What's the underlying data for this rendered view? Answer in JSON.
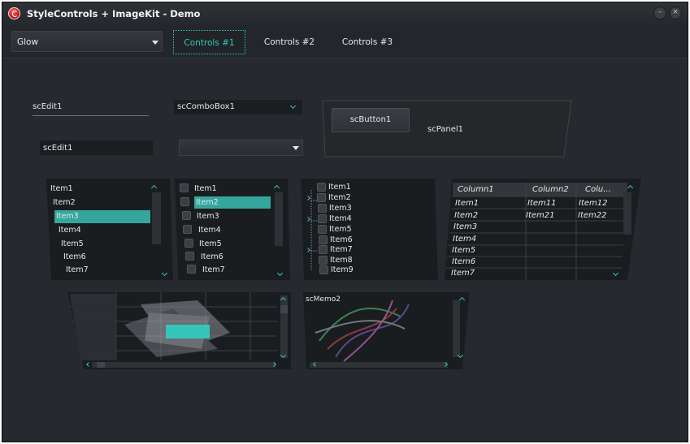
{
  "window": {
    "title": "StyleControls + ImageKit  - Demo",
    "minimize_glyph": "–",
    "close_glyph": "×"
  },
  "style_combo": {
    "value": "Glow"
  },
  "tabs": [
    {
      "label": "Controls #1",
      "active": true
    },
    {
      "label": "Controls #2",
      "active": false
    },
    {
      "label": "Controls #3",
      "active": false
    }
  ],
  "edits": {
    "edit1": "scEdit1",
    "edit2": "scEdit1"
  },
  "combos": {
    "combo1": "scComboBox1",
    "combo2": ""
  },
  "panel": {
    "button_label": "scButton1",
    "panel_label": "scPanel1"
  },
  "listbox1": {
    "items": [
      "Item1",
      "Item2",
      "Item3",
      "Item4",
      "Item5",
      "Item6",
      "Item7"
    ],
    "selected": "Item3"
  },
  "checklist": {
    "items": [
      "Item1",
      "Item2",
      "Item3",
      "Item4",
      "Item5",
      "Item6",
      "Item7"
    ],
    "selected": "Item2"
  },
  "tree": {
    "items": [
      "Item1",
      "Item2",
      "Item3",
      "Item4",
      "Item5",
      "Item6",
      "Item7",
      "Item8",
      "Item9"
    ]
  },
  "grid": {
    "columns": [
      "Column1",
      "Column2",
      "Colu..."
    ],
    "rows": [
      [
        "Item1",
        "Item11",
        "Item12"
      ],
      [
        "Item2",
        "Item21",
        "Item22"
      ],
      [
        "Item3",
        "",
        ""
      ],
      [
        "Item4",
        "",
        ""
      ],
      [
        "Item5",
        "",
        ""
      ],
      [
        "Item6",
        "",
        ""
      ],
      [
        "Item7",
        "",
        ""
      ]
    ]
  },
  "memo": {
    "label": "scMemo2"
  },
  "colors": {
    "accent": "#35c6ba",
    "selection": "#35a69c",
    "background": "#262a2e",
    "field": "#1b1e21"
  },
  "icons": [
    "app-logo-icon",
    "minimize-icon",
    "close-icon",
    "chevron-down-icon",
    "chevron-up-icon",
    "chevron-left-icon",
    "chevron-right-icon",
    "tree-expand-icon"
  ]
}
